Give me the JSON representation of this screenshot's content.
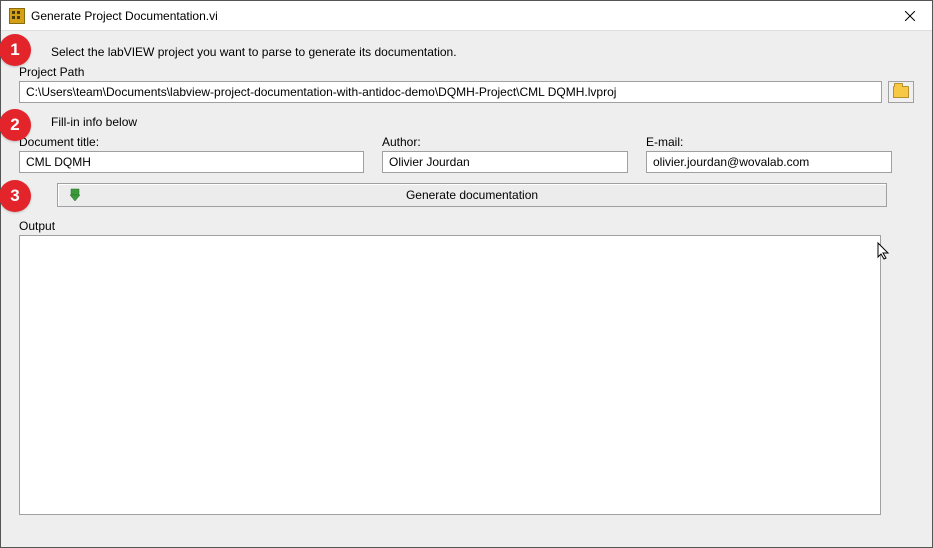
{
  "window": {
    "title": "Generate Project Documentation.vi"
  },
  "steps": {
    "badge1": "1",
    "badge2": "2",
    "badge3": "3",
    "instruction1": "Select the labVIEW project you want to  parse to generate its documentation.",
    "instruction2": "Fill-in info below"
  },
  "projectPath": {
    "label": "Project Path",
    "value": "C:\\Users\\team\\Documents\\labview-project-documentation-with-antidoc-demo\\DQMH-Project\\CML DQMH.lvproj"
  },
  "docTitle": {
    "label": "Document title:",
    "value": "CML DQMH"
  },
  "author": {
    "label": "Author:",
    "value": "Olivier Jourdan"
  },
  "email": {
    "label": "E-mail:",
    "value": "olivier.jourdan@wovalab.com"
  },
  "generateButton": {
    "label": "Generate documentation"
  },
  "output": {
    "label": "Output",
    "value": ""
  }
}
